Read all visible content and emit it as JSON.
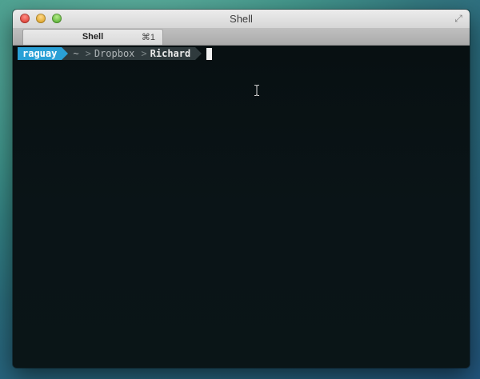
{
  "window": {
    "title": "Shell",
    "buttons": [
      "close",
      "minimize",
      "zoom"
    ],
    "fullscreen_icon": "fullscreen-arrows-icon"
  },
  "tabs": [
    {
      "label": "Shell",
      "shortcut": "⌘1",
      "active": true
    }
  ],
  "prompt": {
    "user": "raguay",
    "path": [
      "~",
      "Dropbox",
      "Richard"
    ],
    "separator": ">"
  },
  "colors": {
    "user_segment": "#2aa0d6",
    "path_segment": "#2f3a3d",
    "terminal_bg": "#0a1417"
  }
}
